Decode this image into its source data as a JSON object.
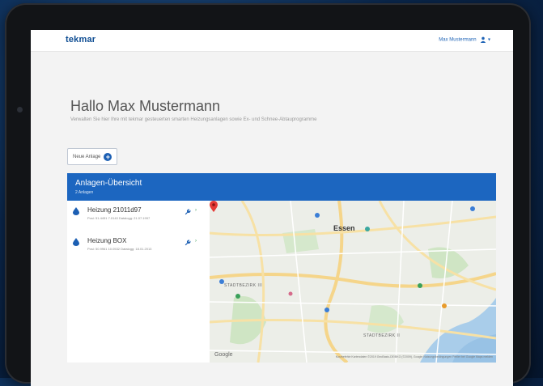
{
  "header": {
    "logo": "tekmar",
    "user_name": "Max Mustermann"
  },
  "greeting": "Hallo Max Mustermann",
  "subtitle": "Verwalten Sie hier Ihre mit tekmar gesteuerten smarten Heizungsanlagen sowie Ex- und Schnee-Abtauprogramme",
  "new_button": {
    "label": "Neue Anlage"
  },
  "overview": {
    "title": "Anlagen-Übersicht",
    "count": "2 Anlagen",
    "items": [
      {
        "name": "Heizung 21011d97",
        "meta": "Posi: 51.4451 7.0140 Datalogg: 21.07.1997"
      },
      {
        "name": "Heizung BOX",
        "meta": "Posi: 50.9961 10.0532 Datalogg: 18.01.2013"
      }
    ]
  },
  "map": {
    "city": "Essen",
    "districts": [
      "STADTBEZIRK III",
      "STADTBEZIRK II"
    ],
    "google": "Google",
    "attribution": "Kurzbefehle   Kartendaten ©2019 GeoBasis-DE/BKG (©2009), Google   Nutzungsbedingungen   Fehler bei Google Maps melden"
  },
  "colors": {
    "brand": "#0d4c92",
    "panel": "#1c66c0",
    "water": "#a9cdea",
    "road": "#f5d58a"
  }
}
